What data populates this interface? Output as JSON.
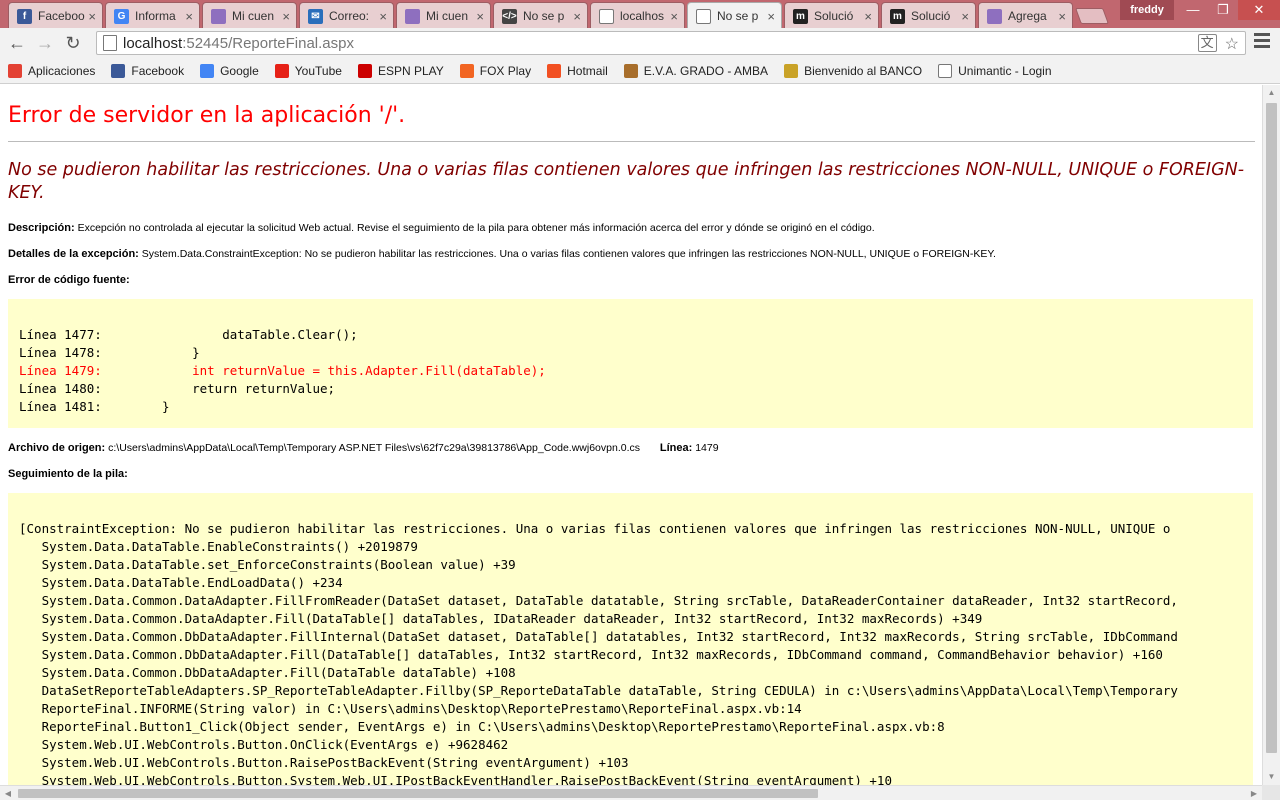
{
  "browser": {
    "tabs": [
      {
        "title": "Faceboo",
        "icon": "facebook-icon",
        "color": "#3b5998",
        "glyph": "f"
      },
      {
        "title": "Informa",
        "icon": "google-icon",
        "color": "#4285f4",
        "glyph": "G"
      },
      {
        "title": "Mi cuen",
        "icon": "page-icon",
        "color": "#8e6fbf",
        "glyph": ""
      },
      {
        "title": "Correo:",
        "icon": "mail-icon",
        "color": "#2a6ebb",
        "glyph": "✉"
      },
      {
        "title": "Mi cuen",
        "icon": "page-icon",
        "color": "#8e6fbf",
        "glyph": ""
      },
      {
        "title": "No se p",
        "icon": "code-icon",
        "color": "#444444",
        "glyph": "</>"
      },
      {
        "title": "localhos",
        "icon": "document-icon",
        "color": "#ffffff",
        "glyph": ""
      },
      {
        "title": "No se p",
        "icon": "document-icon",
        "color": "#ffffff",
        "glyph": ""
      },
      {
        "title": "Solució",
        "icon": "m-icon",
        "color": "#222222",
        "glyph": "m"
      },
      {
        "title": "Solució",
        "icon": "m-icon",
        "color": "#222222",
        "glyph": "m"
      },
      {
        "title": "Agrega",
        "icon": "page-icon",
        "color": "#8e6fbf",
        "glyph": ""
      }
    ],
    "active_tab": 7,
    "profile_name": "freddy",
    "window_buttons": {
      "minimize": "—",
      "maximize": "❐",
      "close": "✕"
    },
    "url_host": "localhost",
    "url_path": ":52445/ReporteFinal.aspx",
    "bookmarks": [
      {
        "label": "Aplicaciones",
        "icon": "apps-grid-icon",
        "color": "#e34133"
      },
      {
        "label": "Facebook",
        "icon": "facebook-icon",
        "color": "#3b5998"
      },
      {
        "label": "Google",
        "icon": "google-icon",
        "color": "#4285f4"
      },
      {
        "label": "YouTube",
        "icon": "youtube-icon",
        "color": "#e62117"
      },
      {
        "label": "ESPN PLAY",
        "icon": "espn-icon",
        "color": "#cc0000"
      },
      {
        "label": "FOX Play",
        "icon": "fox-icon",
        "color": "#f26522"
      },
      {
        "label": "Hotmail",
        "icon": "windows-icon",
        "color": "#f25022"
      },
      {
        "label": "E.V.A. GRADO - AMBA",
        "icon": "eva-icon",
        "color": "#a86e2b"
      },
      {
        "label": "Bienvenido al BANCO",
        "icon": "bank-icon",
        "color": "#c9a227"
      },
      {
        "label": "Unimantic - Login",
        "icon": "document-icon",
        "color": "#ffffff"
      }
    ]
  },
  "page": {
    "title": "Error de servidor en la aplicación '/'.",
    "subtitle": "No se pudieron habilitar las restricciones. Una o varias filas contienen valores que infringen las restricciones NON-NULL, UNIQUE o FOREIGN-KEY.",
    "description_label": "Descripción:",
    "description_text": "Excepción no controlada al ejecutar la solicitud Web actual. Revise el seguimiento de la pila para obtener más información acerca del error y dónde se originó en el código.",
    "exception_label": "Detalles de la excepción:",
    "exception_text": "System.Data.ConstraintException: No se pudieron habilitar las restricciones. Una o varias filas contienen valores que infringen las restricciones NON-NULL, UNIQUE o FOREIGN-KEY.",
    "source_error_label": "Error de código fuente:",
    "source_lines": [
      "Línea 1477:                dataTable.Clear();",
      "Línea 1478:            }",
      "Línea 1479:            int returnValue = this.Adapter.Fill(dataTable);",
      "Línea 1480:            return returnValue;",
      "Línea 1481:        }"
    ],
    "highlight_line": 2,
    "source_file_label": "Archivo de origen:",
    "source_file": "c:\\Users\\admins\\AppData\\Local\\Temp\\Temporary ASP.NET Files\\vs\\62f7c29a\\39813786\\App_Code.wwj6ovpn.0.cs",
    "line_label": "Línea:",
    "line_number": "1479",
    "stack_label": "Seguimiento de la pila:",
    "stack_lines": [
      "[ConstraintException: No se pudieron habilitar las restricciones. Una o varias filas contienen valores que infringen las restricciones NON-NULL, UNIQUE o",
      "   System.Data.DataTable.EnableConstraints() +2019879",
      "   System.Data.DataTable.set_EnforceConstraints(Boolean value) +39",
      "   System.Data.DataTable.EndLoadData() +234",
      "   System.Data.Common.DataAdapter.FillFromReader(DataSet dataset, DataTable datatable, String srcTable, DataReaderContainer dataReader, Int32 startRecord,",
      "   System.Data.Common.DataAdapter.Fill(DataTable[] dataTables, IDataReader dataReader, Int32 startRecord, Int32 maxRecords) +349",
      "   System.Data.Common.DbDataAdapter.FillInternal(DataSet dataset, DataTable[] datatables, Int32 startRecord, Int32 maxRecords, String srcTable, IDbCommand",
      "   System.Data.Common.DbDataAdapter.Fill(DataTable[] dataTables, Int32 startRecord, Int32 maxRecords, IDbCommand command, CommandBehavior behavior) +160",
      "   System.Data.Common.DbDataAdapter.Fill(DataTable dataTable) +108",
      "   DataSetReporteTableAdapters.SP_ReporteTableAdapter.Fillby(SP_ReporteDataTable dataTable, String CEDULA) in c:\\Users\\admins\\AppData\\Local\\Temp\\Temporary",
      "   ReporteFinal.INFORME(String valor) in C:\\Users\\admins\\Desktop\\ReportePrestamo\\ReporteFinal.aspx.vb:14",
      "   ReporteFinal.Button1_Click(Object sender, EventArgs e) in C:\\Users\\admins\\Desktop\\ReportePrestamo\\ReporteFinal.aspx.vb:8",
      "   System.Web.UI.WebControls.Button.OnClick(EventArgs e) +9628462",
      "   System.Web.UI.WebControls.Button.RaisePostBackEvent(String eventArgument) +103",
      "   System.Web.UI.WebControls.Button.System.Web.UI.IPostBackEventHandler.RaisePostBackEvent(String eventArgument) +10"
    ]
  }
}
